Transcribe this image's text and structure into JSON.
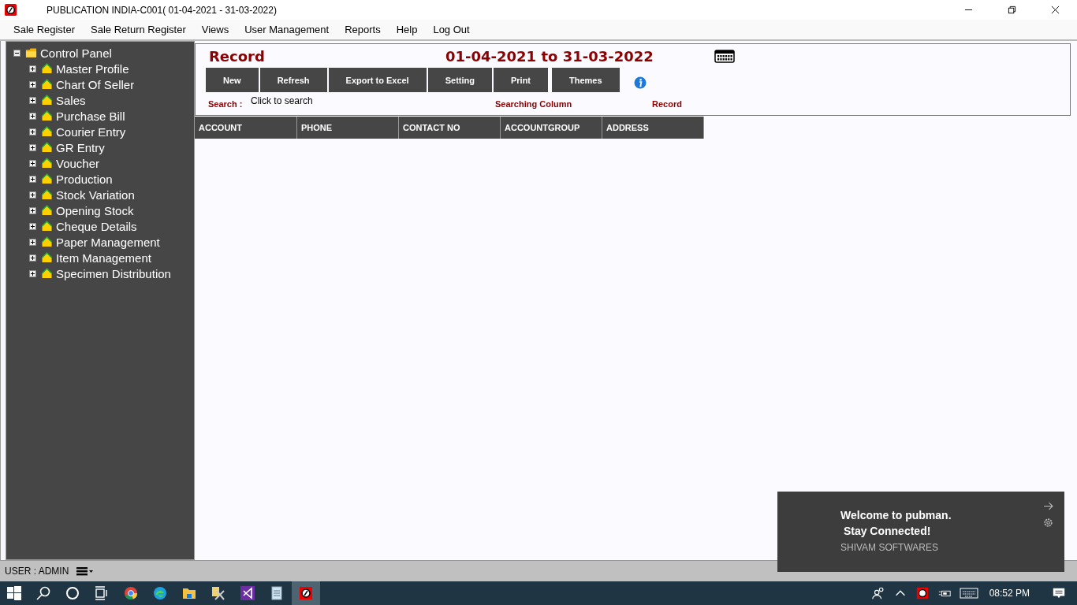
{
  "window": {
    "title": "PUBLICATION INDIA-C001( 01-04-2021 - 31-03-2022)"
  },
  "menu": [
    "Sale Register",
    "Sale Return Register",
    "Views",
    "User Management",
    "Reports",
    "Help",
    "Log Out"
  ],
  "tree": {
    "label": "Control Panel",
    "expanded": true,
    "children": [
      {
        "label": "Master Profile",
        "expanded": false
      },
      {
        "label": "Chart Of Seller",
        "expanded": false
      },
      {
        "label": "Sales",
        "expanded": false
      },
      {
        "label": "Purchase Bill",
        "expanded": false
      },
      {
        "label": "Courier Entry",
        "expanded": false
      },
      {
        "label": "GR Entry",
        "expanded": false
      },
      {
        "label": "Voucher",
        "expanded": false
      },
      {
        "label": "Production",
        "expanded": false
      },
      {
        "label": "Stock Variation",
        "expanded": false
      },
      {
        "label": "Opening Stock",
        "expanded": false
      },
      {
        "label": "Cheque Details",
        "expanded": false
      },
      {
        "label": "Paper Management",
        "expanded": false
      },
      {
        "label": "Item Management",
        "expanded": false
      },
      {
        "label": "Specimen Distribution",
        "expanded": false
      }
    ]
  },
  "panel": {
    "heading": "Record",
    "period": "01-04-2021 to 31-03-2022",
    "buttons": [
      "New",
      "Refresh",
      "Export to Excel",
      "Setting",
      "Print",
      "Themes"
    ],
    "search_label": "Search :",
    "search_placeholder": "Click to search",
    "searching_column_label": "Searching Column",
    "record_label": "Record"
  },
  "table": {
    "columns": [
      "ACCOUNT",
      "PHONE",
      "CONTACT NO",
      "ACCOUNTGROUP",
      "ADDRESS"
    ]
  },
  "status_bar": {
    "user": "USER : ADMIN"
  },
  "toast": {
    "title": "Welcome to pubman.",
    "subtitle": " Stay Connected!",
    "source": "SHIVAM SOFTWARES"
  },
  "taskbar": {
    "apps": [
      {
        "kind": "start",
        "selected": false
      },
      {
        "kind": "search",
        "selected": false
      },
      {
        "kind": "cortana",
        "selected": false
      },
      {
        "kind": "taskview",
        "selected": false
      },
      {
        "kind": "chrome",
        "selected": false
      },
      {
        "kind": "edge",
        "selected": false
      },
      {
        "kind": "explorer",
        "selected": false
      },
      {
        "kind": "tools",
        "selected": false
      },
      {
        "kind": "vstudio",
        "selected": false
      },
      {
        "kind": "notepad",
        "selected": false
      },
      {
        "kind": "pubman",
        "selected": true
      }
    ],
    "clock": "08:52 PM"
  }
}
